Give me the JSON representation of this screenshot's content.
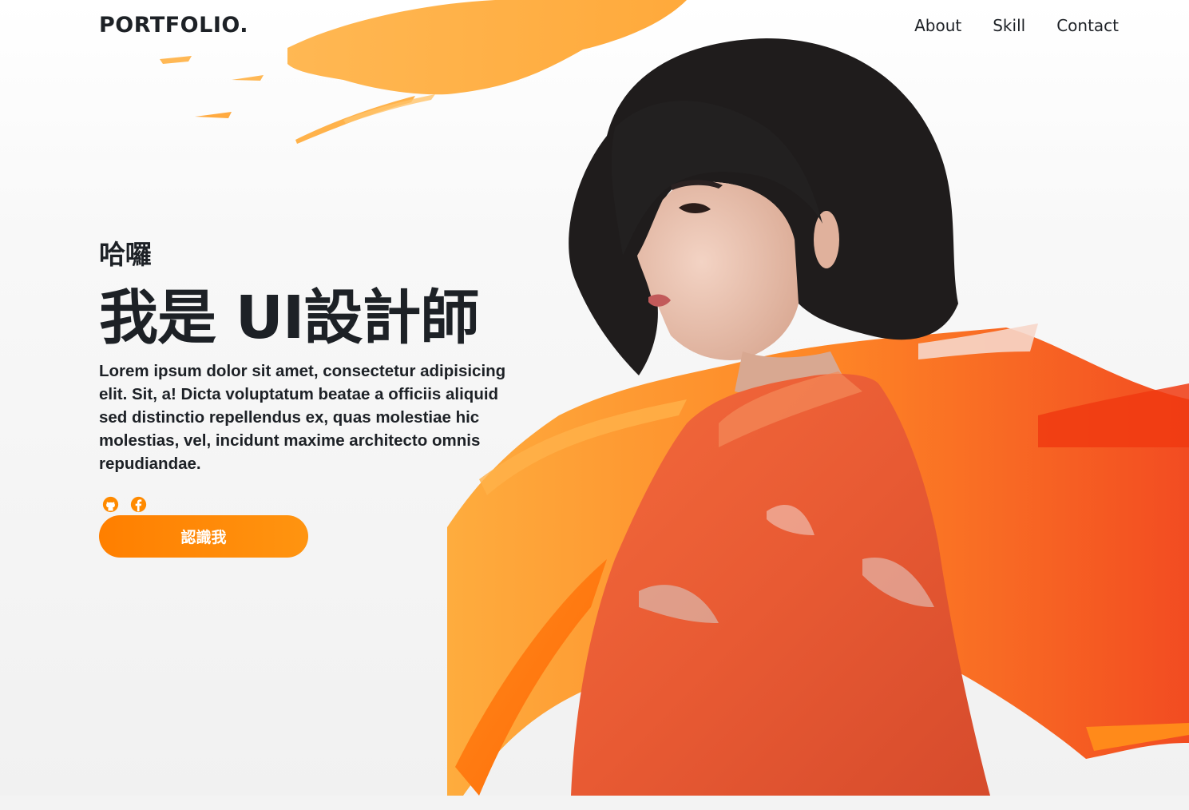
{
  "nav": {
    "brand": "PORTFOLIO.",
    "links": [
      "About",
      "Skill",
      "Contact"
    ]
  },
  "hero": {
    "greeting": "哈囉",
    "headline": "我是 UI設計師",
    "intro": "Lorem ipsum dolor sit amet, consectetur adipisicing elit. Sit, a! Dicta voluptatum beatae a officiis aliquid sed distinctio repellendus ex, quas molestiae hic molestias, vel, incidunt maxime architecto omnis repudiandae.",
    "cta_label": "認識我",
    "socials": [
      "github-icon",
      "facebook-icon"
    ]
  },
  "colors": {
    "accent": "#ff8a00",
    "text": "#1d2126",
    "paint_orange": "#ff7a12",
    "paint_red": "#f23d10"
  }
}
